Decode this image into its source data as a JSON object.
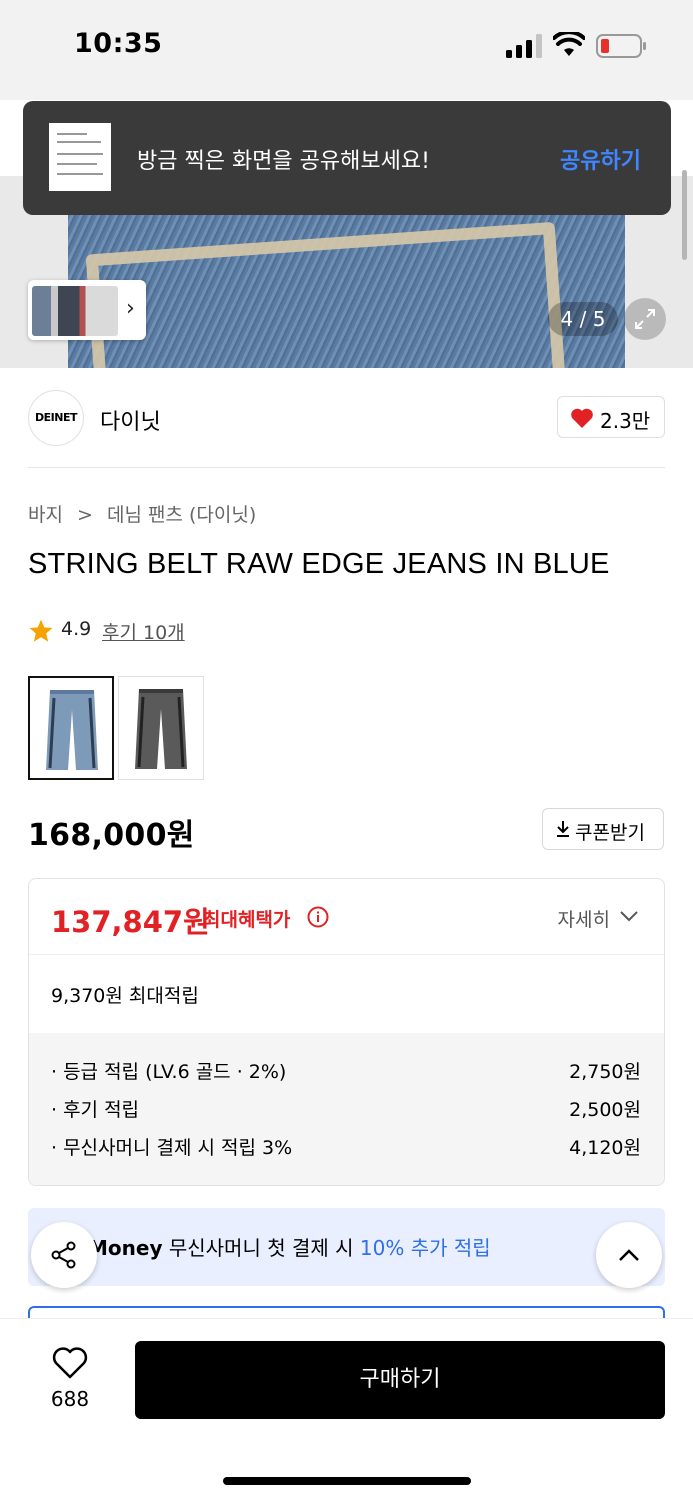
{
  "status_bar": {
    "time": "10:35"
  },
  "toast": {
    "message": "방금 찍은 화면을 공유해보세요!",
    "action": "공유하기"
  },
  "gallery": {
    "counter": "4 / 5"
  },
  "brand": {
    "logo_text": "DEINET",
    "name": "다이닛",
    "like_count": "2.3만"
  },
  "breadcrumb": {
    "category": "바지",
    "separator": ">",
    "subcategory": "데님 팬츠 (다이닛)"
  },
  "product": {
    "title": "STRING BELT RAW EDGE JEANS IN BLUE",
    "rating": "4.9",
    "reviews": "후기 10개",
    "colors": [
      "blue",
      "black"
    ],
    "price": "168,000원",
    "coupon_label": "쿠폰받기"
  },
  "benefit": {
    "best_price": "137,847원",
    "best_label": "최대혜택가",
    "detail_label": "자세히",
    "max_points": "9,370원 최대적립",
    "rows": [
      {
        "label": "· 등급 적립 (LV.6 골드 · 2%)",
        "value": "2,750원"
      },
      {
        "label": "· 후기 적립",
        "value": "2,500원"
      },
      {
        "label": "· 무신사머니 결제 시 적립 3%",
        "value": "4,120원"
      }
    ]
  },
  "promo": {
    "brand": "Money",
    "text": "무신사머니 첫 결제 시",
    "highlight": "10% 추가 적립"
  },
  "bottom": {
    "wish_count": "688",
    "buy_label": "구매하기"
  },
  "colors": {
    "accent_red": "#e22125",
    "accent_blue": "#2f6fe8",
    "toast_bg": "#3a3a3a"
  }
}
